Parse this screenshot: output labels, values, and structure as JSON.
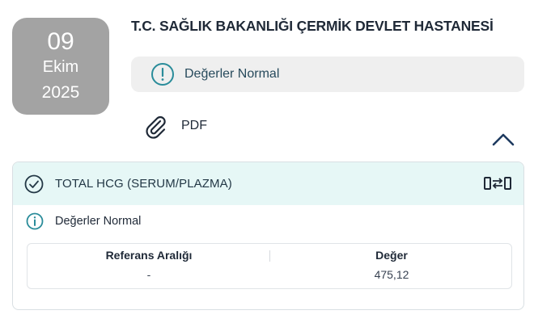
{
  "date": {
    "day": "09",
    "month": "Ekim",
    "year": "2025"
  },
  "hospital_name": "T.C. SAĞLIK BAKANLIĞI ÇERMİK DEVLET HASTANESİ",
  "status": {
    "text": "Değerler Normal",
    "icon": "info-circle-icon"
  },
  "attachment": {
    "label": "PDF",
    "icon": "paperclip-icon"
  },
  "collapse_icon": "chevron-up-icon",
  "test": {
    "name": "TOTAL HCG (SERUM/PLAZMA)",
    "status_text": "Değerler Normal",
    "columns": [
      "Referans Aralığı",
      "Değer"
    ],
    "reference_range": "-",
    "value": "475,12"
  },
  "colors": {
    "date_box": "#a3a3a3",
    "accent": "#2a8c9a",
    "header_bg": "#e6f7f6",
    "pill_bg": "#efefef"
  }
}
